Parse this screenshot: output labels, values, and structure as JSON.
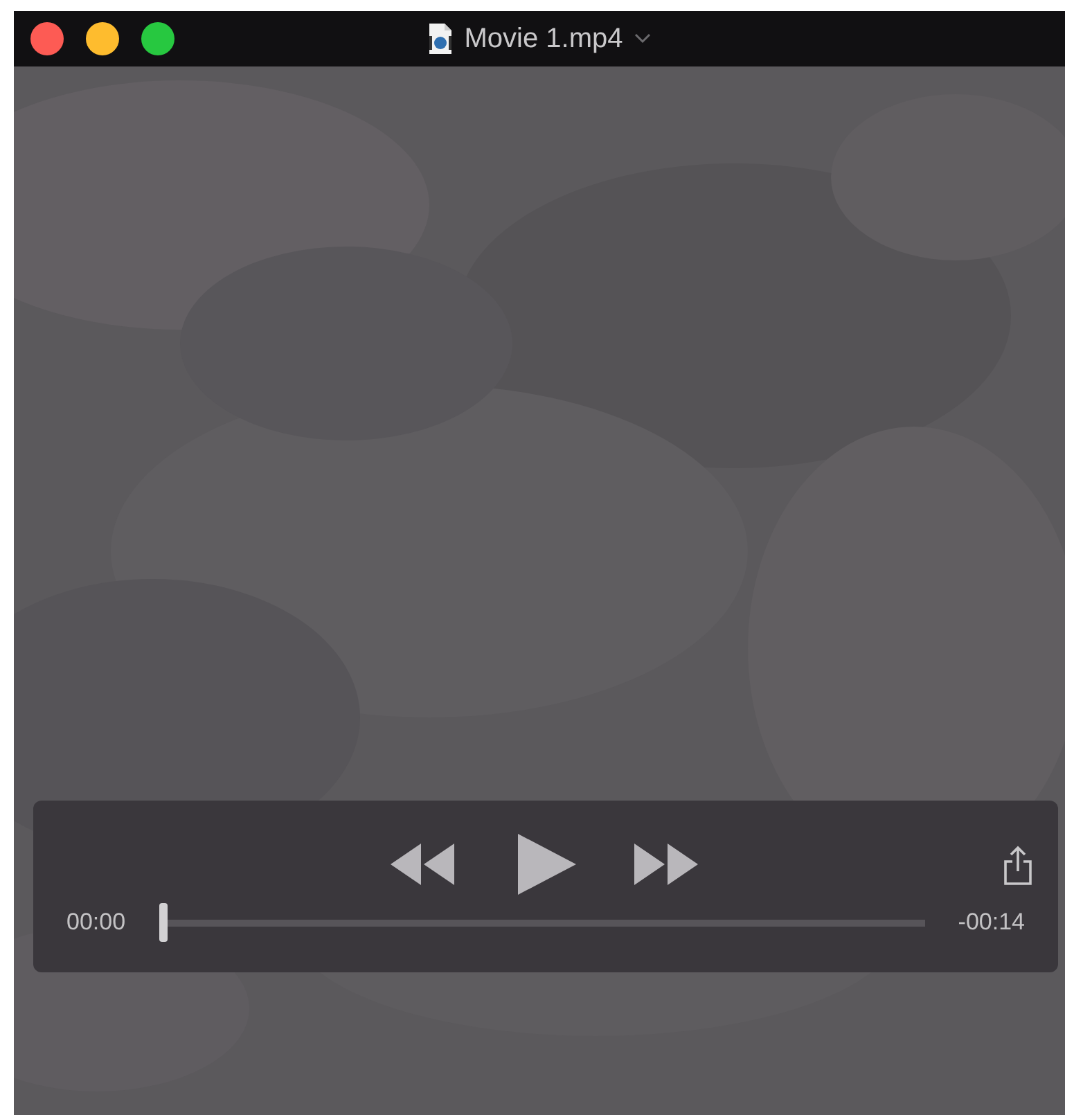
{
  "window": {
    "title": "Movie 1.mp4"
  },
  "controls": {
    "elapsed": "00:00",
    "remaining": "-00:14",
    "playing": false,
    "progress": {
      "level": 0
    }
  }
}
